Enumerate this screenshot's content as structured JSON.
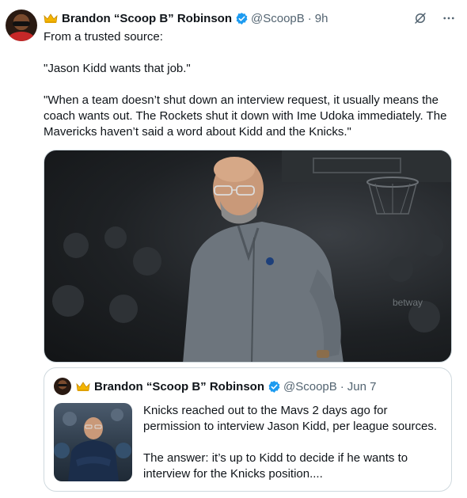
{
  "tweet": {
    "author_name": "Brandon “Scoop B” Robinson",
    "handle": "@ScoopB",
    "separator": "·",
    "time": "9h",
    "text_lines": [
      "From a trusted source:",
      "\"Jason Kidd wants that job.\"",
      "\"When a team doesn’t shut down an interview request, it usually means the coach wants out. The Rockets shut it down with Ime Udoka immediately. The Mavericks haven’t said a word about Kidd and the Knicks.\""
    ]
  },
  "quoted_tweet": {
    "author_name": "Brandon “Scoop B” Robinson",
    "handle": "@ScoopB",
    "separator": "·",
    "time": "Jun 7",
    "text_lines": [
      "Knicks reached out to the Mavs 2 days ago for permission to interview Jason Kidd, per league sources.",
      "The answer: it’s up to Kidd to decide if he wants to interview for the Knicks position...."
    ]
  },
  "media_overlay_text": {
    "sponsor": "betway"
  },
  "colors": {
    "text": "#0f1419",
    "secondary": "#536471",
    "verified": "#1d9bf0",
    "border": "#cfd9de"
  },
  "icons": [
    "crown-icon",
    "verified-icon",
    "grok-icon",
    "more-icon"
  ]
}
